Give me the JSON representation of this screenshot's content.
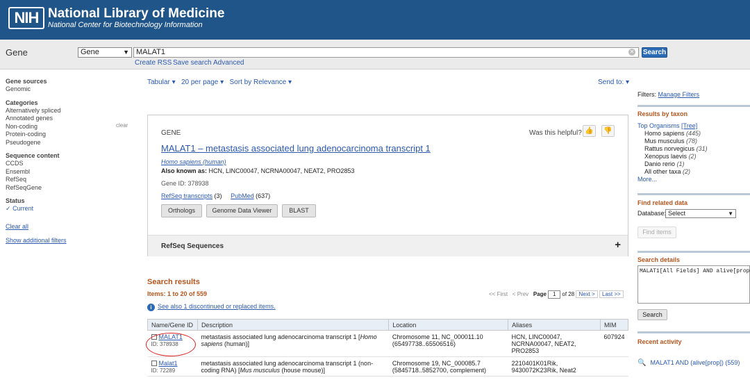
{
  "header": {
    "logo": "NIH",
    "title": "National Library of Medicine",
    "subtitle": "National Center for Biotechnology Information"
  },
  "search": {
    "db_name": "Gene",
    "db_select": "Gene",
    "query": "MALAT1",
    "button": "Search",
    "links": [
      "Create RSS",
      "Save search",
      "Advanced"
    ]
  },
  "left": {
    "groups": [
      {
        "head": "Gene sources",
        "items": [
          "Genomic"
        ]
      },
      {
        "head": "Categories",
        "items": [
          "Alternatively spliced",
          "Annotated genes",
          "Non-coding",
          "Protein-coding",
          "Pseudogene"
        ]
      },
      {
        "head": "Sequence content",
        "items": [
          "CCDS",
          "Ensembl",
          "RefSeq",
          "RefSeqGene"
        ]
      },
      {
        "head": "Status",
        "items": [
          "Current"
        ]
      }
    ],
    "clear_label": "clear",
    "clear_all": "Clear all",
    "show_filters": "Show additional filters",
    "selected_mark": "✓"
  },
  "toolbar": {
    "format": "Tabular",
    "per_page": "20 per page",
    "sort": "Sort by Relevance",
    "send_to": "Send to:"
  },
  "gene_panel": {
    "type": "GENE",
    "helpful": "Was this helpful?",
    "title": "MALAT1 – metastasis associated lung adenocarcinoma transcript 1",
    "organism": "Homo sapiens (human)",
    "aka_label": "Also known as:",
    "aka": "HCN, LINC00047, NCRNA00047, NEAT2, PRO2853",
    "gene_id": "Gene ID: 378938",
    "refseq_link": "RefSeq transcripts",
    "refseq_count": "(3)",
    "pubmed_link": "PubMed",
    "pubmed_count": "(637)",
    "buttons": [
      "Orthologs",
      "Genome Data Viewer",
      "BLAST"
    ],
    "refseq_section": "RefSeq Sequences"
  },
  "results": {
    "title": "Search results",
    "items": "Items: 1 to 20 of 559",
    "pager": {
      "first": "<< First",
      "prev": "< Prev",
      "page_label": "Page",
      "page": "1",
      "of": "of 28",
      "next": "Next >",
      "last": "Last >>"
    },
    "see_also": "See also 1 discontinued or replaced items.",
    "columns": [
      "Name/Gene ID",
      "Description",
      "Location",
      "Aliases",
      "MIM"
    ],
    "rows": [
      {
        "name": "MALAT1",
        "id": "ID: 378938",
        "desc": "metastasis associated lung adenocarcinoma transcript 1 [",
        "desc_org": "Homo sapiens",
        "desc_tail": " (human)]",
        "location": "Chromosome 11, NC_000011.10 (65497738..65506516)",
        "aliases": "HCN, LINC00047, NCRNA00047, NEAT2, PRO2853",
        "mim": "607924"
      },
      {
        "name": "Malat1",
        "id": "ID: 72289",
        "desc": "metastasis associated lung adenocarcinoma transcript 1 (non-coding RNA) [",
        "desc_org": "Mus musculus",
        "desc_tail": " (house mouse)]",
        "location": "Chromosome 19, NC_000085.7 (5845718..5852700, complement)",
        "aliases": "2210401K01Rik, 9430072K23Rik, Neat2",
        "mim": ""
      }
    ]
  },
  "right": {
    "filters_label": "Filters:",
    "manage_filters": "Manage Filters",
    "by_taxon_head": "Results by taxon",
    "top_organisms": "Top Organisms",
    "tree": "[Tree]",
    "taxa": [
      {
        "name": "Homo sapiens",
        "count": "(445)"
      },
      {
        "name": "Mus musculus",
        "count": "(78)"
      },
      {
        "name": "Rattus norvegicus",
        "count": "(31)"
      },
      {
        "name": "Xenopus laevis",
        "count": "(2)"
      },
      {
        "name": "Danio rerio",
        "count": "(1)"
      },
      {
        "name": "All other taxa",
        "count": "(2)"
      }
    ],
    "more": "More...",
    "related_head": "Find related data",
    "database_label": "Database:",
    "database_value": "Select",
    "find_items": "Find items",
    "details_head": "Search details",
    "details_query": "MALAT1[All Fields] AND alive[prop]",
    "details_button": "Search",
    "recent_head": "Recent activity",
    "recent_item": "MALAT1 AND (alive[prop]) (559)"
  }
}
